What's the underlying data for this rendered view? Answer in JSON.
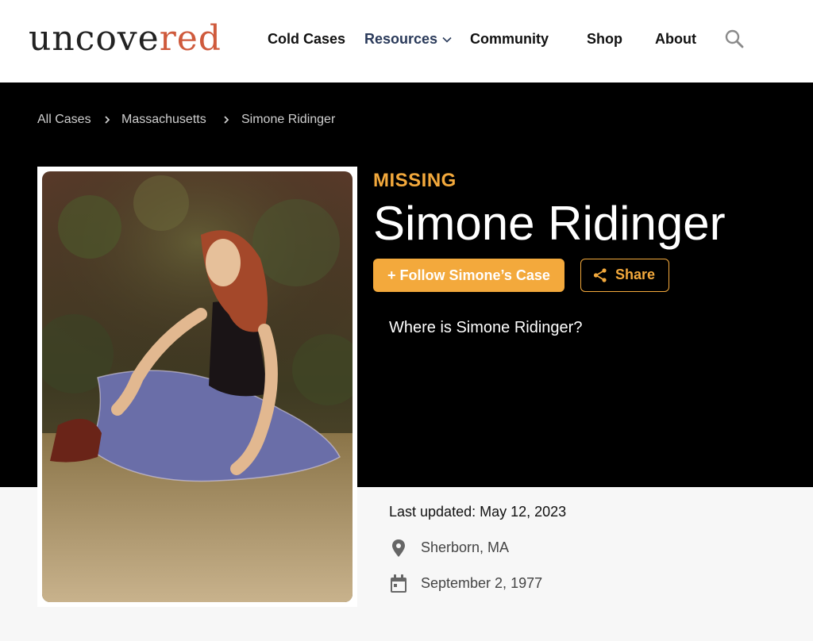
{
  "brand": {
    "logo_part1": "uncove",
    "logo_part2": "red",
    "accent_color": "#cf5a3c"
  },
  "nav": {
    "items": [
      {
        "label": "Cold Cases"
      },
      {
        "label": "Resources",
        "has_dropdown": true
      },
      {
        "label": "Community"
      },
      {
        "label": "Shop"
      },
      {
        "label": "About"
      }
    ],
    "search_icon": "search-icon"
  },
  "breadcrumb": [
    "All Cases",
    "Massachusetts",
    "Simone Ridinger"
  ],
  "case": {
    "status": "MISSING",
    "name": "Simone Ridinger",
    "follow_label": "+ Follow Simone’s Case",
    "share_label": "Share",
    "question": "Where is Simone Ridinger?",
    "last_updated": "Last updated: May 12, 2023",
    "location": "Sherborn, MA",
    "date": "September 2, 1977"
  },
  "colors": {
    "status": "#f3a93c",
    "hero_bg": "#000000"
  }
}
